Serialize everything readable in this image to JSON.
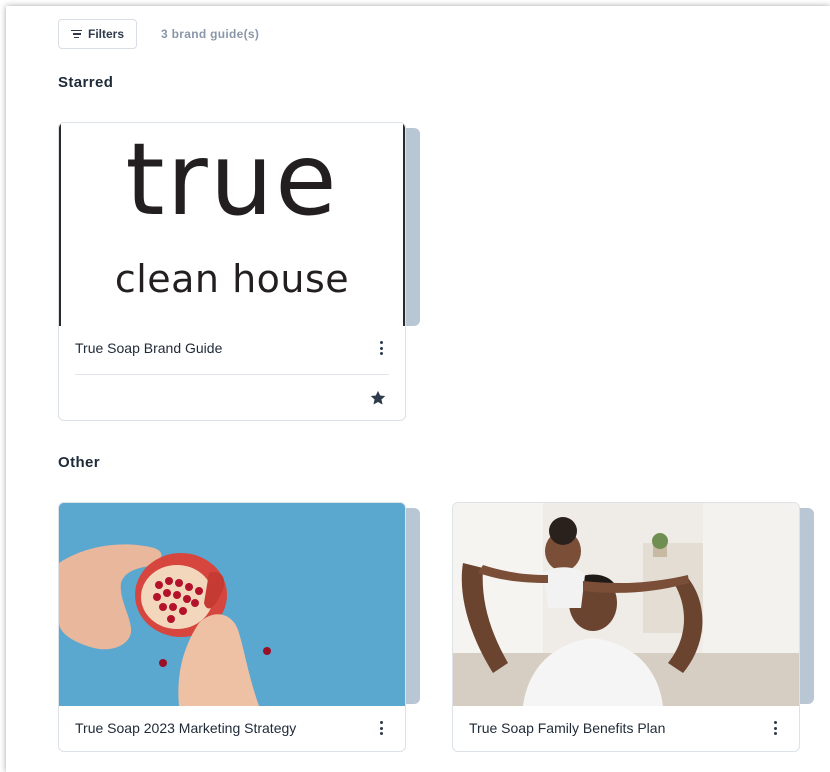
{
  "toolbar": {
    "filters_label": "Filters",
    "count_text": "3 brand guide(s)"
  },
  "sections": {
    "starred_title": "Starred",
    "other_title": "Other"
  },
  "cards": [
    {
      "title": "True Soap Brand Guide",
      "starred": true,
      "logo_main": "true",
      "logo_sub": "clean house"
    },
    {
      "title": "True Soap 2023 Marketing Strategy",
      "starred": false
    },
    {
      "title": "True Soap Family Benefits Plan",
      "starred": false
    }
  ],
  "colors": {
    "stack": "#b9c6d3",
    "text": "#1f2a37",
    "muted": "#8a97a8",
    "star": "#2f3b4a"
  }
}
